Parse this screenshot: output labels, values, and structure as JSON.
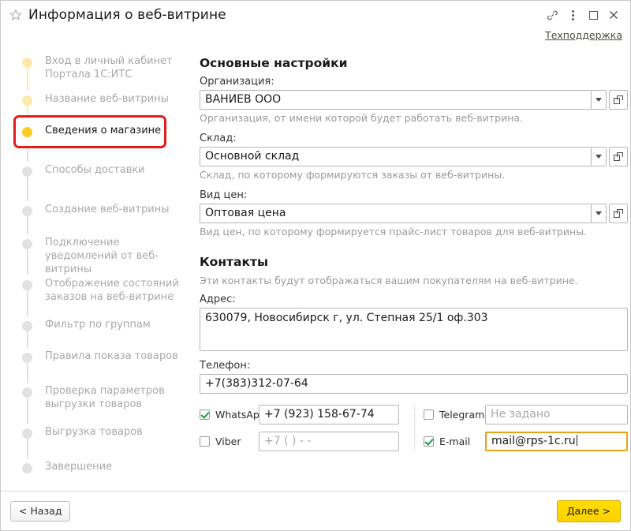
{
  "window": {
    "title": "Информация о веб-витрине",
    "favorite_icon": "star-icon",
    "link_icon": "link-icon",
    "menu_icon": "kebab-menu-icon",
    "maximize_icon": "maximize-icon",
    "close_icon": "close-icon",
    "support_link": "Техподдержка"
  },
  "sidebar": {
    "steps": [
      {
        "label": "Вход в личный кабинет Портала 1С:ИТС",
        "state": "done"
      },
      {
        "label": "Название веб-витрины",
        "state": "done"
      },
      {
        "label": "Сведения о магазине",
        "state": "active"
      },
      {
        "label": "Способы доставки",
        "state": "pending"
      },
      {
        "label": "Создание веб-витрины",
        "state": "pending"
      },
      {
        "label": "Подключение уведомлений от веб-витрины",
        "state": "pending"
      },
      {
        "label": "Отображение состояний заказов на веб-витрине",
        "state": "pending"
      },
      {
        "label": "Фильтр по группам",
        "state": "pending"
      },
      {
        "label": "Правила показа товаров",
        "state": "pending"
      },
      {
        "label": "Проверка параметров выгрузки товаров",
        "state": "pending"
      },
      {
        "label": "Выгрузка товаров",
        "state": "pending"
      },
      {
        "label": "Завершение",
        "state": "pending"
      }
    ]
  },
  "main": {
    "basic_settings": {
      "heading": "Основные настройки",
      "organization": {
        "label": "Организация:",
        "value": "ВАНИЕВ ООО",
        "hint": "Организация, от имени которой будет работать веб-витрина."
      },
      "warehouse": {
        "label": "Склад:",
        "value": "Основной склад",
        "hint": "Склад, по которому формируются заказы от веб-витрины."
      },
      "price_type": {
        "label": "Вид цен:",
        "value": "Оптовая цена",
        "hint": "Вид цен, по которому формируется прайс-лист товаров для веб-витрины."
      }
    },
    "contacts": {
      "heading": "Контакты",
      "subtitle": "Эти контакты будут отображаться вашим покупателям на веб-витрине.",
      "address": {
        "label": "Адрес:",
        "value": "630079, Новосибирск г, ул. Степная 25/1 оф.303"
      },
      "phone": {
        "label": "Телефон:",
        "value": "+7(383)312-07-64"
      },
      "messengers": [
        {
          "name": "whatsapp",
          "label": "WhatsApp",
          "checked": true,
          "value": "+7 (923) 158-67-74",
          "placeholder": ""
        },
        {
          "name": "viber",
          "label": "Viber",
          "checked": false,
          "value": "",
          "placeholder": "+7 (  )    -  -"
        },
        {
          "name": "telegram",
          "label": "Telegram",
          "checked": false,
          "value": "",
          "placeholder": "Не задано"
        },
        {
          "name": "email",
          "label": "E-mail",
          "checked": true,
          "value": "mail@rps-1c.ru",
          "placeholder": "",
          "focused": true
        }
      ]
    }
  },
  "footer": {
    "back_label": "< Назад",
    "next_label": "Далее >"
  },
  "colors": {
    "accent_yellow": "#ffca28",
    "step_done": "#ffe9a8",
    "step_pending": "#e2e2e2",
    "highlight_red": "#e01c1c",
    "check_green": "#1f9d3a",
    "focus_gold": "#e8a317",
    "next_button": "#ffdd00"
  }
}
